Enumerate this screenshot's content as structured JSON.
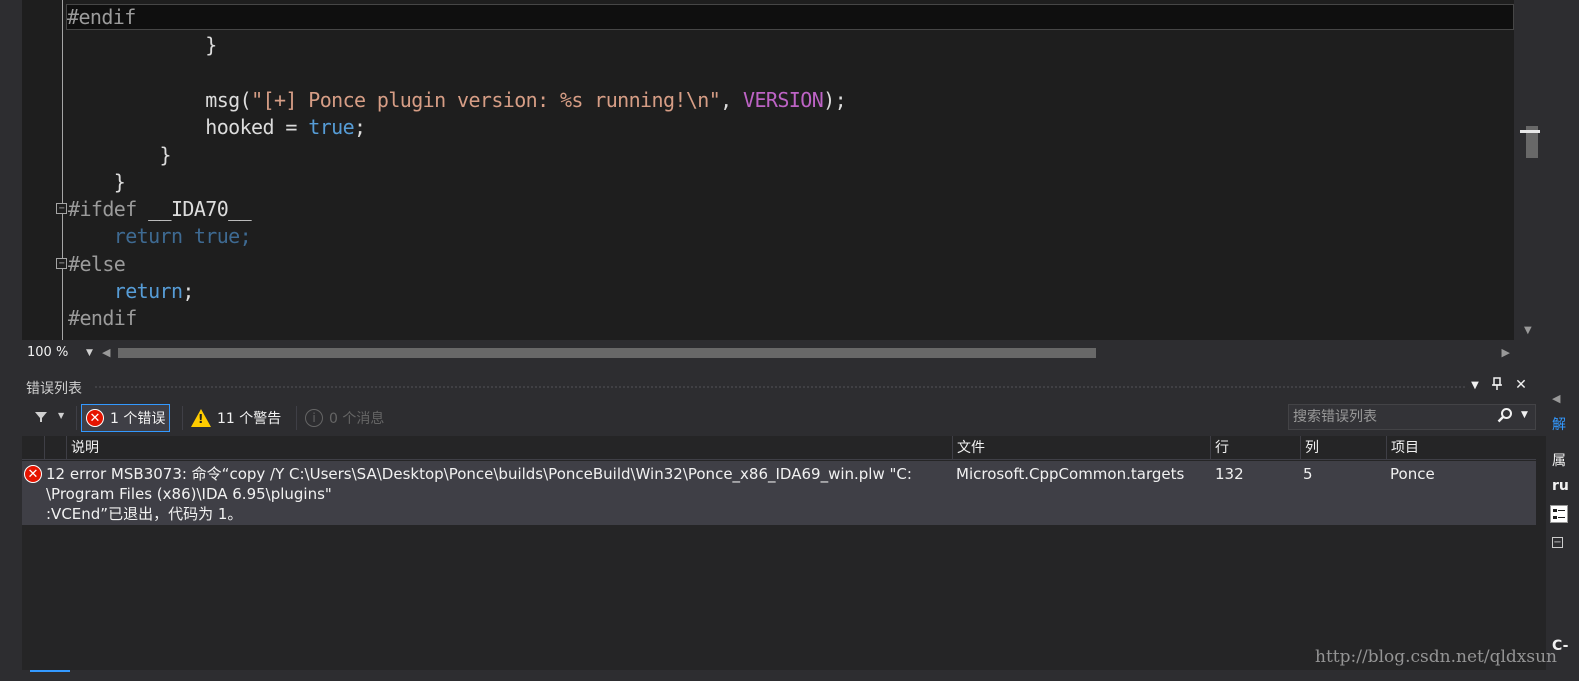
{
  "editor": {
    "lines": [
      {
        "indent": "",
        "tokens": [
          {
            "t": "#endif",
            "c": "pp"
          }
        ],
        "current": true
      },
      {
        "indent": "            ",
        "tokens": [
          {
            "t": "}",
            "c": ""
          }
        ]
      },
      {
        "indent": "",
        "tokens": []
      },
      {
        "indent": "            ",
        "tokens": [
          {
            "t": "msg(",
            "c": ""
          },
          {
            "t": "\"[+] Ponce plugin version: %s running!\\n\"",
            "c": "str"
          },
          {
            "t": ", ",
            "c": ""
          },
          {
            "t": "VERSION",
            "c": "macro"
          },
          {
            "t": ");",
            "c": ""
          }
        ]
      },
      {
        "indent": "            ",
        "tokens": [
          {
            "t": "hooked = ",
            "c": ""
          },
          {
            "t": "true",
            "c": "kw"
          },
          {
            "t": ";",
            "c": ""
          }
        ]
      },
      {
        "indent": "        ",
        "tokens": [
          {
            "t": "}",
            "c": ""
          }
        ]
      },
      {
        "indent": "    ",
        "tokens": [
          {
            "t": "}",
            "c": ""
          }
        ]
      },
      {
        "indent": "",
        "tokens": [
          {
            "t": "#ifdef ",
            "c": "pp"
          },
          {
            "t": "__IDA70__",
            "c": ""
          }
        ],
        "collapse": true
      },
      {
        "indent": "    ",
        "tokens": [
          {
            "t": "return true;",
            "c": "dim"
          }
        ]
      },
      {
        "indent": "",
        "tokens": [
          {
            "t": "#else",
            "c": "pp"
          }
        ],
        "collapse": true
      },
      {
        "indent": "    ",
        "tokens": [
          {
            "t": "return",
            "c": "kw"
          },
          {
            "t": ";",
            "c": ""
          }
        ]
      },
      {
        "indent": "",
        "tokens": [
          {
            "t": "#endif",
            "c": "pp"
          }
        ]
      }
    ],
    "zoom": "100 %"
  },
  "error_list": {
    "title": "错误列表",
    "buttons": {
      "dropdown": "▼",
      "pin": "📌",
      "close": "✕"
    },
    "filters": {
      "errors_label": "1 个错误",
      "warnings_label": "11 个警告",
      "messages_label": "0 个消息"
    },
    "search": {
      "placeholder": "搜索错误列表"
    },
    "columns": {
      "description": "说明",
      "file": "文件",
      "line": "行",
      "column": "列",
      "project": "项目"
    },
    "rows": [
      {
        "description": "12 error MSB3073: 命令“copy /Y C:\\Users\\SA\\Desktop\\Ponce\\builds\\PonceBuild\\Win32\\Ponce_x86_IDA69_win.plw \"C:\n\\Program Files (x86)\\IDA 6.95\\plugins\"\n:VCEnd”已退出，代码为 1。",
        "file": "Microsoft.CppCommon.targets",
        "line": "132",
        "column": "5",
        "project": "Ponce"
      }
    ]
  },
  "right_strip": {
    "item1": "解",
    "item2": "属",
    "item3": "ru",
    "item4": "C-"
  },
  "watermark": "http://blog.csdn.net/qldxsun",
  "colors": {
    "editor_bg": "#1e1e1e",
    "panel_bg": "#252526",
    "chrome_bg": "#2d2d30",
    "selected_row": "#3f3f46",
    "accent": "#3399ff",
    "error_red": "#e51400",
    "warning_yellow": "#ffcc00"
  }
}
